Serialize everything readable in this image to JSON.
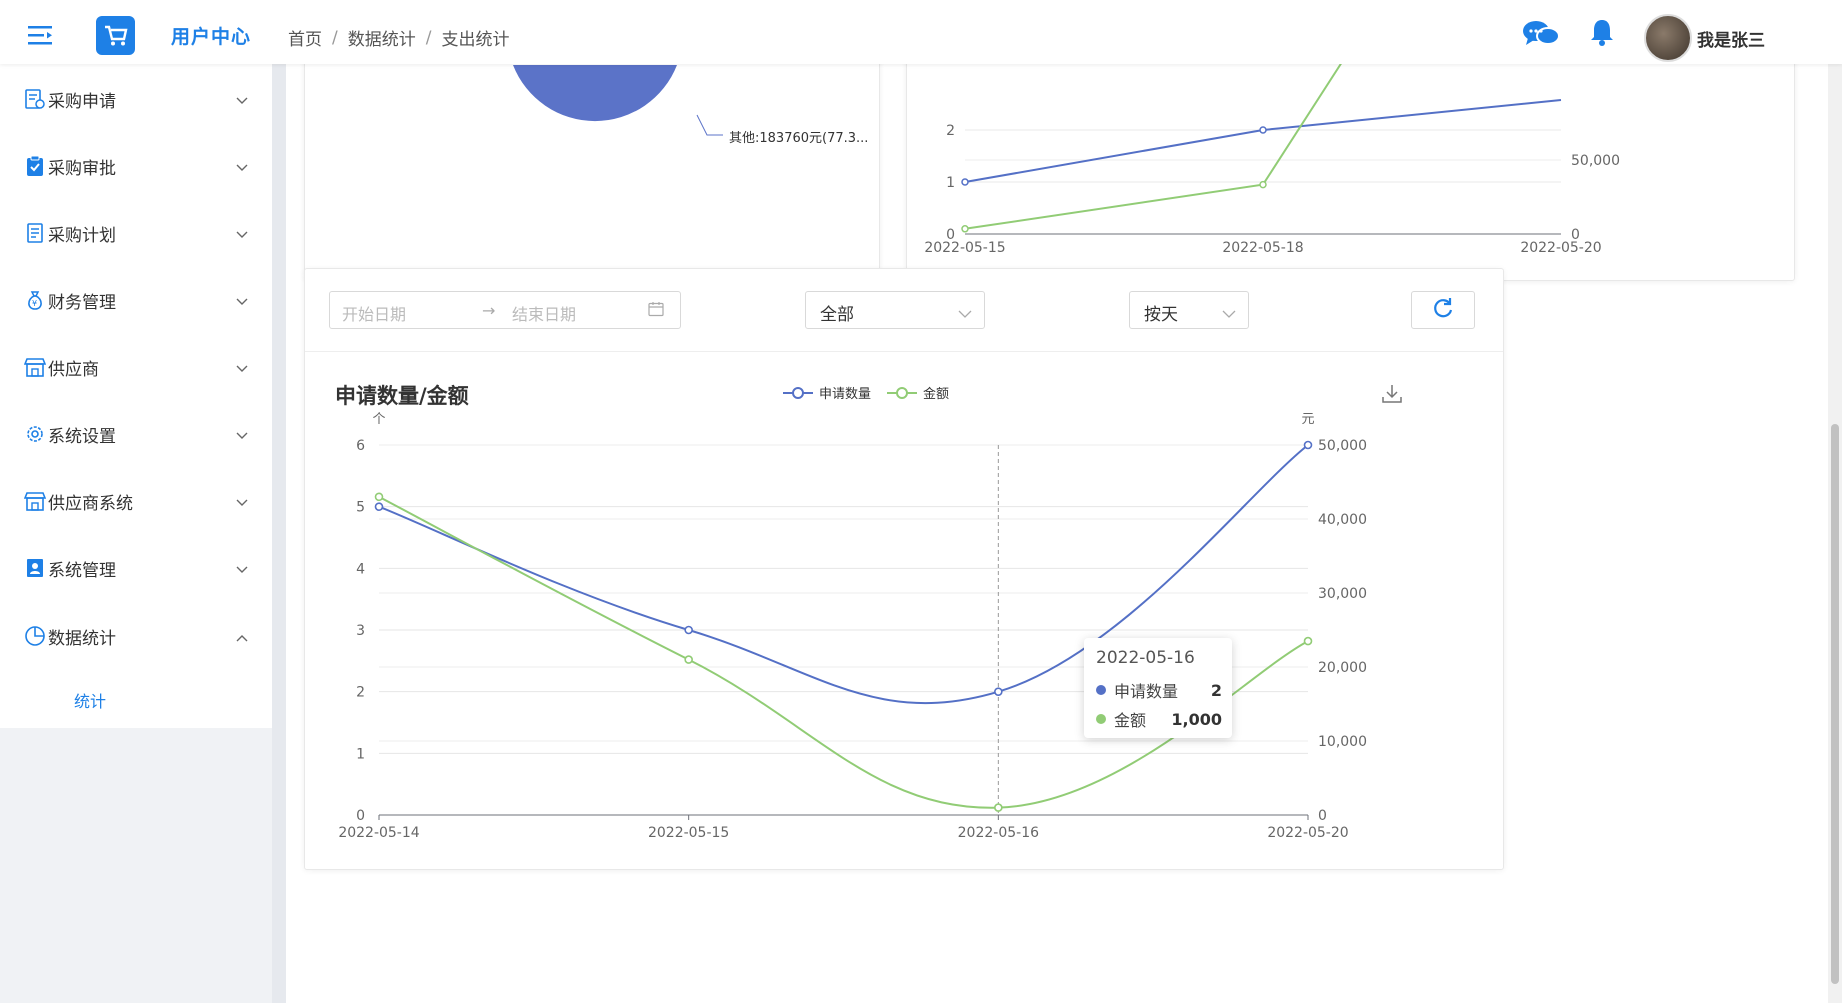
{
  "header": {
    "app_title": "用户中心",
    "breadcrumb": [
      "首页",
      "数据统计",
      "支出统计"
    ],
    "username": "我是张三"
  },
  "sidebar": {
    "items": [
      {
        "label": "采购申请",
        "icon": "form-icon"
      },
      {
        "label": "采购审批",
        "icon": "clipboard-check-icon"
      },
      {
        "label": "采购计划",
        "icon": "document-icon"
      },
      {
        "label": "财务管理",
        "icon": "money-bag-icon"
      },
      {
        "label": "供应商",
        "icon": "store-icon"
      },
      {
        "label": "系统设置",
        "icon": "gear-icon"
      },
      {
        "label": "供应商系统",
        "icon": "store-icon"
      },
      {
        "label": "系统管理",
        "icon": "user-badge-icon"
      },
      {
        "label": "数据统计",
        "icon": "pie-chart-icon"
      }
    ],
    "sub_item": "统计"
  },
  "top_left_card": {
    "pie_label": "其他:183760元(77.3..."
  },
  "top_right_chart": {
    "x_ticks": [
      "2022-05-15",
      "2022-05-18",
      "2022-05-20"
    ],
    "left_ticks": [
      "0",
      "1",
      "2"
    ],
    "right_ticks": [
      "0",
      "50,000"
    ],
    "series": [
      {
        "x": [
          "2022-05-15",
          "2022-05-18"
        ],
        "values": [
          1,
          2
        ],
        "color": "#5470c6"
      },
      {
        "x": [
          "2022-05-15",
          "2022-05-18"
        ],
        "values": [
          0.1,
          0.95
        ],
        "color": "#91cc75"
      }
    ]
  },
  "filters": {
    "start_placeholder": "开始日期",
    "end_placeholder": "结束日期",
    "category_value": "全部",
    "period_value": "按天"
  },
  "chart_data": {
    "type": "line",
    "title": "申请数量/金额",
    "x": [
      "2022-05-14",
      "2022-05-15",
      "2022-05-16",
      "2022-05-20"
    ],
    "y_left_unit": "个",
    "y_right_unit": "元",
    "y_left_range": [
      0,
      6
    ],
    "y_right_range": [
      0,
      50000
    ],
    "y_left_ticks": [
      "0",
      "1",
      "2",
      "3",
      "4",
      "5",
      "6"
    ],
    "y_right_ticks": [
      "0",
      "10,000",
      "20,000",
      "30,000",
      "40,000",
      "50,000"
    ],
    "legend_placement": "top-center",
    "grid": true,
    "series": [
      {
        "name": "申请数量",
        "axis": "left",
        "values": [
          5,
          3,
          2,
          6
        ],
        "color": "#5470c6"
      },
      {
        "name": "金额",
        "axis": "right",
        "values": [
          43000,
          21000,
          1000,
          23500
        ],
        "color": "#91cc75"
      }
    ]
  },
  "tooltip": {
    "date": "2022-05-16",
    "rows": [
      {
        "label": "申请数量",
        "value": "2",
        "color": "#5470c6"
      },
      {
        "label": "金额",
        "value": "1,000",
        "color": "#91cc75"
      }
    ]
  }
}
